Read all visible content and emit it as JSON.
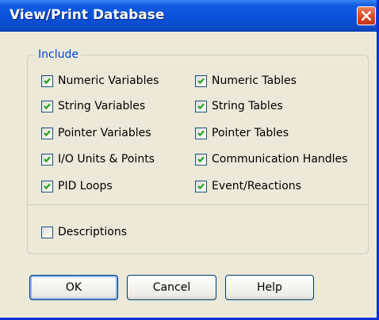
{
  "window": {
    "title": "View/Print Database",
    "title_color": "#FFFFFF",
    "titlebar_color": "#0A50D8",
    "close_icon": "close-x-icon",
    "close_color": "#D94F29"
  },
  "include": {
    "legend": "Include",
    "legend_color": "#0046D5",
    "left_items": [
      {
        "label": "Numeric Variables",
        "checked": true
      },
      {
        "label": "String Variables",
        "checked": true
      },
      {
        "label": "Pointer Variables",
        "checked": true
      },
      {
        "label": "I/O Units & Points",
        "checked": true
      },
      {
        "label": "PID Loops",
        "checked": true
      }
    ],
    "right_items": [
      {
        "label": "Numeric Tables",
        "checked": true
      },
      {
        "label": "String Tables",
        "checked": true
      },
      {
        "label": "Pointer Tables",
        "checked": true
      },
      {
        "label": "Communication Handles",
        "checked": true
      },
      {
        "label": "Event/Reactions",
        "checked": true
      }
    ],
    "descriptions": {
      "label": "Descriptions",
      "checked": false
    }
  },
  "buttons": {
    "ok": "OK",
    "cancel": "Cancel",
    "help": "Help"
  },
  "check_color": "#21A121"
}
